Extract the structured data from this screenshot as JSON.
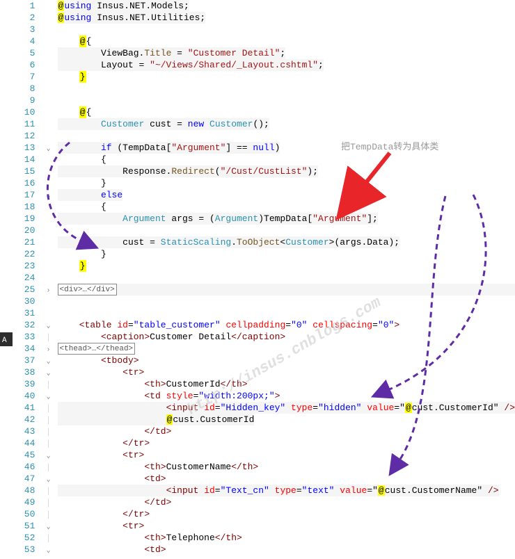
{
  "annotation_text": "把TempData转为具体类",
  "watermark_text": "http://insus.cnblogs.com",
  "lines": [
    {
      "n": 1,
      "fold": "",
      "code": [
        {
          "t": "at-hl",
          "v": "@"
        },
        {
          "t": "kw",
          "v": "using"
        },
        {
          "t": "txt",
          "v": " "
        },
        {
          "t": "txt",
          "v": "Insus.NET.Models;"
        }
      ],
      "hl": true
    },
    {
      "n": 2,
      "fold": "",
      "code": [
        {
          "t": "at-hl",
          "v": "@"
        },
        {
          "t": "kw",
          "v": "using"
        },
        {
          "t": "txt",
          "v": " Insus.NET.Utilities;"
        }
      ],
      "hl": true
    },
    {
      "n": 3,
      "fold": "",
      "code": []
    },
    {
      "n": 4,
      "fold": "",
      "code": [
        {
          "t": "txt",
          "v": "    "
        },
        {
          "t": "at-hl",
          "v": "@"
        },
        {
          "t": "txt",
          "v": "{"
        }
      ]
    },
    {
      "n": 5,
      "fold": "",
      "code": [
        {
          "t": "txt",
          "v": "        ViewBag."
        },
        {
          "t": "mth",
          "v": "Title"
        },
        {
          "t": "txt",
          "v": " = "
        },
        {
          "t": "str",
          "v": "\"Customer Detail\""
        },
        {
          "t": "txt",
          "v": ";"
        }
      ],
      "hl": true
    },
    {
      "n": 6,
      "fold": "",
      "code": [
        {
          "t": "txt",
          "v": "        Layout = "
        },
        {
          "t": "str",
          "v": "\"~/Views/Shared/_Layout.cshtml\""
        },
        {
          "t": "txt",
          "v": ";"
        }
      ],
      "hl": true
    },
    {
      "n": 7,
      "fold": "",
      "code": [
        {
          "t": "txt",
          "v": "    "
        },
        {
          "t": "at-hl",
          "v": "}"
        }
      ],
      "hlend": true
    },
    {
      "n": 8,
      "fold": "",
      "code": []
    },
    {
      "n": 9,
      "fold": "",
      "code": []
    },
    {
      "n": 10,
      "fold": "",
      "code": [
        {
          "t": "txt",
          "v": "    "
        },
        {
          "t": "at-hl",
          "v": "@"
        },
        {
          "t": "txt",
          "v": "{"
        }
      ]
    },
    {
      "n": 11,
      "fold": "",
      "code": [
        {
          "t": "txt",
          "v": "        "
        },
        {
          "t": "tp",
          "v": "Customer"
        },
        {
          "t": "txt",
          "v": " cust = "
        },
        {
          "t": "kw",
          "v": "new"
        },
        {
          "t": "txt",
          "v": " "
        },
        {
          "t": "tp",
          "v": "Customer"
        },
        {
          "t": "txt",
          "v": "();"
        }
      ],
      "hl": true
    },
    {
      "n": 12,
      "fold": "",
      "code": []
    },
    {
      "n": 13,
      "fold": "v",
      "code": [
        {
          "t": "txt",
          "v": "        "
        },
        {
          "t": "kw",
          "v": "if"
        },
        {
          "t": "txt",
          "v": " (TempData["
        },
        {
          "t": "str",
          "v": "\"Argument\""
        },
        {
          "t": "txt",
          "v": "] == "
        },
        {
          "t": "kw",
          "v": "null"
        },
        {
          "t": "txt",
          "v": ")"
        }
      ],
      "hl": true
    },
    {
      "n": 14,
      "fold": "",
      "code": [
        {
          "t": "txt",
          "v": "        {"
        }
      ]
    },
    {
      "n": 15,
      "fold": "",
      "code": [
        {
          "t": "txt",
          "v": "            Response."
        },
        {
          "t": "mth",
          "v": "Redirect"
        },
        {
          "t": "txt",
          "v": "("
        },
        {
          "t": "str",
          "v": "\"/Cust/CustList\""
        },
        {
          "t": "txt",
          "v": ");"
        }
      ],
      "hl": true
    },
    {
      "n": 16,
      "fold": "",
      "code": [
        {
          "t": "txt",
          "v": "        }"
        }
      ]
    },
    {
      "n": 17,
      "fold": "v",
      "code": [
        {
          "t": "txt",
          "v": "        "
        },
        {
          "t": "kw",
          "v": "else"
        }
      ],
      "hl": true
    },
    {
      "n": 18,
      "fold": "",
      "code": [
        {
          "t": "txt",
          "v": "        {"
        }
      ]
    },
    {
      "n": 19,
      "fold": "",
      "code": [
        {
          "t": "txt",
          "v": "            "
        },
        {
          "t": "tp",
          "v": "Argument"
        },
        {
          "t": "txt",
          "v": " args = ("
        },
        {
          "t": "tp",
          "v": "Argument"
        },
        {
          "t": "txt",
          "v": ")TempData["
        },
        {
          "t": "str",
          "v": "\"Argument\""
        },
        {
          "t": "txt",
          "v": "];"
        }
      ],
      "hl": true
    },
    {
      "n": 20,
      "fold": "",
      "code": []
    },
    {
      "n": 21,
      "fold": "",
      "code": [
        {
          "t": "txt",
          "v": "            cust = "
        },
        {
          "t": "tp",
          "v": "StaticScaling"
        },
        {
          "t": "txt",
          "v": "."
        },
        {
          "t": "mth",
          "v": "ToObject"
        },
        {
          "t": "txt",
          "v": "<"
        },
        {
          "t": "tp",
          "v": "Customer"
        },
        {
          "t": "txt",
          "v": ">(args.Data);"
        }
      ],
      "hl": true
    },
    {
      "n": 22,
      "fold": "",
      "code": [
        {
          "t": "txt",
          "v": "        }"
        }
      ]
    },
    {
      "n": 23,
      "fold": "",
      "code": [
        {
          "t": "txt",
          "v": "    "
        },
        {
          "t": "at-hl",
          "v": "}"
        }
      ],
      "hlend": true
    },
    {
      "n": 24,
      "fold": "",
      "code": []
    },
    {
      "n": 25,
      "fold": ">",
      "collapsed": "<div>…</div>",
      "code": [],
      "current": true
    },
    {
      "n": 30,
      "fold": "",
      "code": []
    },
    {
      "n": 31,
      "fold": "",
      "code": []
    },
    {
      "n": 32,
      "fold": "v",
      "code": [
        {
          "t": "txt",
          "v": "    "
        },
        {
          "t": "tag",
          "v": "<table"
        },
        {
          "t": "txt",
          "v": " "
        },
        {
          "t": "attr",
          "v": "id"
        },
        {
          "t": "txt",
          "v": "="
        },
        {
          "t": "aval",
          "v": "\"table_customer\""
        },
        {
          "t": "txt",
          "v": " "
        },
        {
          "t": "attr",
          "v": "cellpadding"
        },
        {
          "t": "txt",
          "v": "="
        },
        {
          "t": "aval",
          "v": "\"0\""
        },
        {
          "t": "txt",
          "v": " "
        },
        {
          "t": "attr",
          "v": "cellspacing"
        },
        {
          "t": "txt",
          "v": "="
        },
        {
          "t": "aval",
          "v": "\"0\""
        },
        {
          "t": "tag",
          "v": ">"
        }
      ]
    },
    {
      "n": 33,
      "fold": "|",
      "code": [
        {
          "t": "txt",
          "v": "        "
        },
        {
          "t": "tag",
          "v": "<caption>"
        },
        {
          "t": "txt",
          "v": "Customer Detail"
        },
        {
          "t": "tag",
          "v": "</caption>"
        }
      ]
    },
    {
      "n": 34,
      "fold": ">",
      "collapsed": "<thead>…</thead>",
      "indent": "        ",
      "code": []
    },
    {
      "n": 37,
      "fold": "v",
      "code": [
        {
          "t": "txt",
          "v": "        "
        },
        {
          "t": "tag",
          "v": "<tbody>"
        }
      ]
    },
    {
      "n": 38,
      "fold": "v",
      "code": [
        {
          "t": "txt",
          "v": "            "
        },
        {
          "t": "tag",
          "v": "<tr>"
        }
      ]
    },
    {
      "n": 39,
      "fold": "|",
      "code": [
        {
          "t": "txt",
          "v": "                "
        },
        {
          "t": "tag",
          "v": "<th>"
        },
        {
          "t": "txt",
          "v": "CustomerId"
        },
        {
          "t": "tag",
          "v": "</th>"
        }
      ]
    },
    {
      "n": 40,
      "fold": "v",
      "code": [
        {
          "t": "txt",
          "v": "                "
        },
        {
          "t": "tag",
          "v": "<td"
        },
        {
          "t": "txt",
          "v": " "
        },
        {
          "t": "attr",
          "v": "style"
        },
        {
          "t": "txt",
          "v": "="
        },
        {
          "t": "aval",
          "v": "\"width:200px;\""
        },
        {
          "t": "tag",
          "v": ">"
        }
      ]
    },
    {
      "n": 41,
      "fold": "|",
      "code": [
        {
          "t": "txt",
          "v": "                    "
        },
        {
          "t": "tag",
          "v": "<input"
        },
        {
          "t": "txt",
          "v": " "
        },
        {
          "t": "attr",
          "v": "id"
        },
        {
          "t": "txt",
          "v": "="
        },
        {
          "t": "aval",
          "v": "\"Hidden_key\""
        },
        {
          "t": "txt",
          "v": " "
        },
        {
          "t": "attr",
          "v": "type"
        },
        {
          "t": "txt",
          "v": "="
        },
        {
          "t": "aval",
          "v": "\"hidden\""
        },
        {
          "t": "txt",
          "v": " "
        },
        {
          "t": "attr",
          "v": "value"
        },
        {
          "t": "txt",
          "v": "=\""
        },
        {
          "t": "at-hl",
          "v": "@"
        },
        {
          "t": "txt",
          "v": "cust.CustomerId"
        },
        {
          "t": "txt",
          "v": "\" "
        },
        {
          "t": "tag",
          "v": "/>"
        }
      ],
      "binding": true
    },
    {
      "n": 42,
      "fold": "|",
      "code": [
        {
          "t": "txt",
          "v": "                    "
        },
        {
          "t": "at-hl",
          "v": "@"
        },
        {
          "t": "txt",
          "v": "cust.CustomerId"
        }
      ],
      "binding": true
    },
    {
      "n": 43,
      "fold": "|",
      "code": [
        {
          "t": "txt",
          "v": "                "
        },
        {
          "t": "tag",
          "v": "</td>"
        }
      ]
    },
    {
      "n": 44,
      "fold": "|",
      "code": [
        {
          "t": "txt",
          "v": "            "
        },
        {
          "t": "tag",
          "v": "</tr>"
        }
      ]
    },
    {
      "n": 45,
      "fold": "v",
      "code": [
        {
          "t": "txt",
          "v": "            "
        },
        {
          "t": "tag",
          "v": "<tr>"
        }
      ]
    },
    {
      "n": 46,
      "fold": "|",
      "code": [
        {
          "t": "txt",
          "v": "                "
        },
        {
          "t": "tag",
          "v": "<th>"
        },
        {
          "t": "txt",
          "v": "CustomerName"
        },
        {
          "t": "tag",
          "v": "</th>"
        }
      ]
    },
    {
      "n": 47,
      "fold": "v",
      "code": [
        {
          "t": "txt",
          "v": "                "
        },
        {
          "t": "tag",
          "v": "<td>"
        }
      ]
    },
    {
      "n": 48,
      "fold": "|",
      "code": [
        {
          "t": "txt",
          "v": "                    "
        },
        {
          "t": "tag",
          "v": "<input"
        },
        {
          "t": "txt",
          "v": " "
        },
        {
          "t": "attr",
          "v": "id"
        },
        {
          "t": "txt",
          "v": "="
        },
        {
          "t": "aval",
          "v": "\"Text_cn\""
        },
        {
          "t": "txt",
          "v": " "
        },
        {
          "t": "attr",
          "v": "type"
        },
        {
          "t": "txt",
          "v": "="
        },
        {
          "t": "aval",
          "v": "\"text\""
        },
        {
          "t": "txt",
          "v": " "
        },
        {
          "t": "attr",
          "v": "value"
        },
        {
          "t": "txt",
          "v": "=\""
        },
        {
          "t": "at-hl",
          "v": "@"
        },
        {
          "t": "txt",
          "v": "cust.CustomerName"
        },
        {
          "t": "txt",
          "v": "\" "
        },
        {
          "t": "tag",
          "v": "/>"
        }
      ],
      "binding": true
    },
    {
      "n": 49,
      "fold": "|",
      "code": [
        {
          "t": "txt",
          "v": "                "
        },
        {
          "t": "tag",
          "v": "</td>"
        }
      ]
    },
    {
      "n": 50,
      "fold": "|",
      "code": [
        {
          "t": "txt",
          "v": "            "
        },
        {
          "t": "tag",
          "v": "</tr>"
        }
      ]
    },
    {
      "n": 51,
      "fold": "v",
      "code": [
        {
          "t": "txt",
          "v": "            "
        },
        {
          "t": "tag",
          "v": "<tr>"
        }
      ]
    },
    {
      "n": 52,
      "fold": "|",
      "code": [
        {
          "t": "txt",
          "v": "                "
        },
        {
          "t": "tag",
          "v": "<th>"
        },
        {
          "t": "txt",
          "v": "Telephone"
        },
        {
          "t": "tag",
          "v": "</th>"
        }
      ]
    },
    {
      "n": 53,
      "fold": "v",
      "code": [
        {
          "t": "txt",
          "v": "                "
        },
        {
          "t": "tag",
          "v": "<td>"
        }
      ]
    }
  ]
}
